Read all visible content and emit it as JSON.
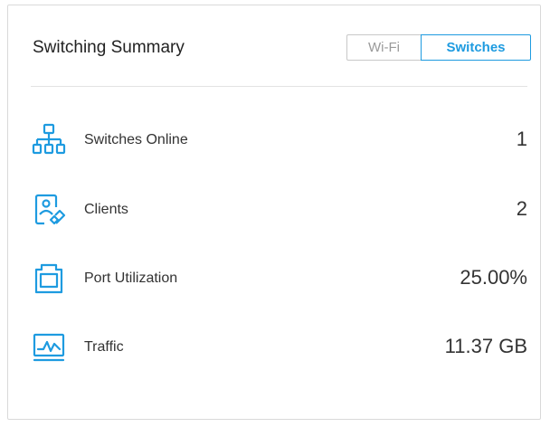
{
  "card": {
    "title": "Switching Summary",
    "tabs": [
      {
        "label": "Wi-Fi",
        "active": false
      },
      {
        "label": "Switches",
        "active": true
      }
    ]
  },
  "stats": [
    {
      "icon": "network-topology-icon",
      "label": "Switches Online",
      "value": "1"
    },
    {
      "icon": "client-device-icon",
      "label": "Clients",
      "value": "2"
    },
    {
      "icon": "ethernet-port-icon",
      "label": "Port Utilization",
      "value": "25.00%"
    },
    {
      "icon": "traffic-chart-icon",
      "label": "Traffic",
      "value": "11.37 GB"
    }
  ],
  "colors": {
    "accent": "#1e9be0",
    "border": "#d9d9d9",
    "text": "#333333",
    "muted": "#9a9a9a"
  }
}
